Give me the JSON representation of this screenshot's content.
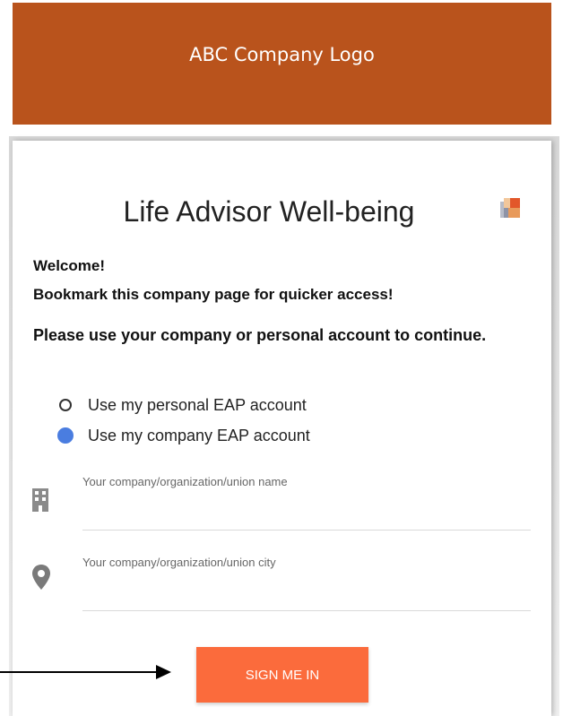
{
  "banner": {
    "text": "ABC Company Logo",
    "color": "#b9531c"
  },
  "card": {
    "title": "Life Advisor Well-being",
    "logo_icon": "life-advisor-logo-icon",
    "welcome": "Welcome!",
    "bookmark": "Bookmark this company page for quicker access!",
    "instructions": "Please use your company or personal account to continue.",
    "options": [
      {
        "label": "Use my personal EAP account",
        "selected": false
      },
      {
        "label": "Use my company EAP account",
        "selected": true
      }
    ],
    "fields": {
      "company_name": {
        "label": "Your company/organization/union name",
        "icon": "building-icon",
        "value": ""
      },
      "company_city": {
        "label": "Your company/organization/union city",
        "icon": "location-pin-icon",
        "value": ""
      }
    },
    "submit_label": "SIGN ME IN",
    "accent_color": "#fb6b3c",
    "radio_selected_color": "#4a7de0"
  },
  "annotation": {
    "icon": "arrow-right-icon"
  }
}
